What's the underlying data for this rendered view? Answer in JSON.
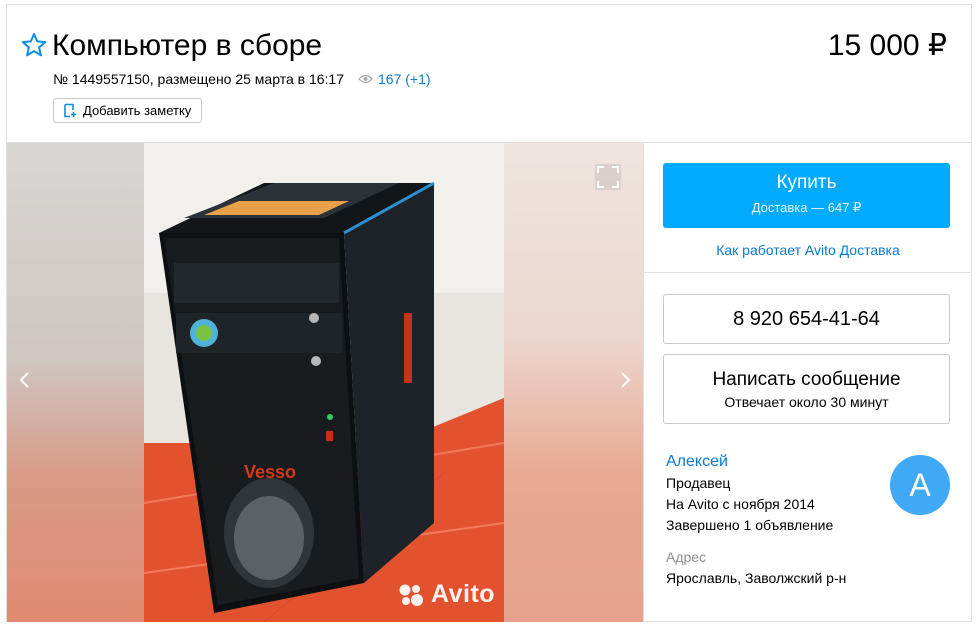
{
  "listing": {
    "title": "Компьютер в сборе",
    "price": "15 000 ₽",
    "meta": "№ 1449557150, размещено 25 марта в 16:17",
    "views": "167 (+1)",
    "note_button": "Добавить заметку"
  },
  "gallery": {
    "watermark": "Avito",
    "photo_labels": {
      "sticker": "Vesso"
    }
  },
  "purchase": {
    "buy_label": "Купить",
    "buy_sub": "Доставка — 647 ₽",
    "delivery_link": "Как работает Avito Доставка"
  },
  "contact": {
    "phone": "8 920 654-41-64",
    "message_label": "Написать сообщение",
    "message_sub": "Отвечает около 30 минут"
  },
  "seller": {
    "name": "Алексей",
    "role": "Продавец",
    "since": "На Avito с ноября 2014",
    "completed": "Завершено 1 объявление",
    "avatar_letter": "А",
    "address_label": "Адрес",
    "address": "Ярославль, Заволжский р-н"
  },
  "colors": {
    "accent": "#00aaff",
    "link": "#0a7ad1",
    "avatar": "#3fa9f5"
  }
}
